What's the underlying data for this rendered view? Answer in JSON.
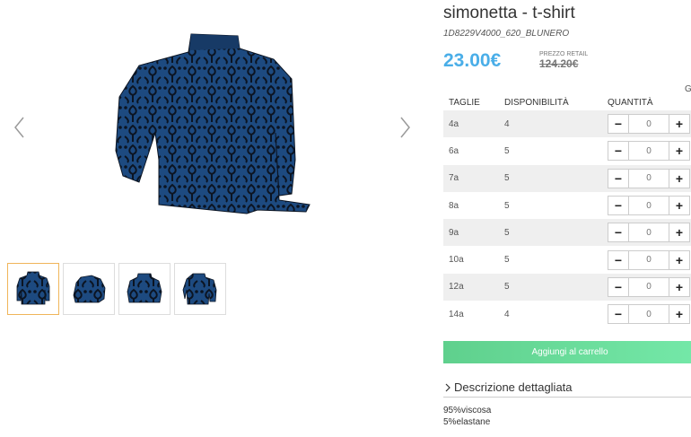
{
  "product": {
    "title": "simonetta - t-shirt",
    "sku": "1D8229V4000_620_BLUNERO",
    "price": "23.00€",
    "retail_label": "PREZZO RETAIL",
    "retail_price": "124.20€",
    "cut_letter": "G"
  },
  "gallery": {
    "main_image_icon": "turtleneck-shirt-image",
    "thumbnails": [
      "thumb-1",
      "thumb-2",
      "thumb-3",
      "thumb-4"
    ],
    "active_thumbnail": 0
  },
  "sizes_table": {
    "headers": [
      "TAGLIE",
      "DISPONIBILITÀ",
      "QUANTITÀ"
    ],
    "rows": [
      {
        "size": "4a",
        "availability": "4",
        "quantity": "0"
      },
      {
        "size": "6a",
        "availability": "5",
        "quantity": "0"
      },
      {
        "size": "7a",
        "availability": "5",
        "quantity": "0"
      },
      {
        "size": "8a",
        "availability": "5",
        "quantity": "0"
      },
      {
        "size": "9a",
        "availability": "5",
        "quantity": "0"
      },
      {
        "size": "10a",
        "availability": "5",
        "quantity": "0"
      },
      {
        "size": "12a",
        "availability": "5",
        "quantity": "0"
      },
      {
        "size": "14a",
        "availability": "4",
        "quantity": "0"
      }
    ],
    "minus_label": "−",
    "plus_label": "+"
  },
  "cart": {
    "button_label": "Aggiungi al carrello"
  },
  "description": {
    "title": "Descrizione dettagliata",
    "lines": [
      "95%viscosa",
      "5%elastane"
    ]
  },
  "colors": {
    "price_blue": "#4aaee8",
    "cart_green": "#5fd08d",
    "garment_blue": "#1d4a80",
    "pattern_dark": "#0b1422",
    "active_thumb_border": "#f0b55a"
  }
}
